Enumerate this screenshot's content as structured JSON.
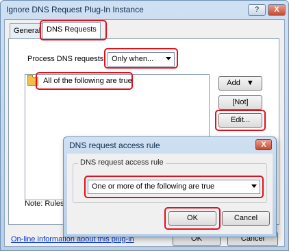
{
  "window": {
    "title": "Ignore DNS Request Plug-In Instance",
    "help_glyph": "?",
    "close_glyph": "X"
  },
  "tabs": [
    {
      "label": "General"
    },
    {
      "label": "DNS Requests"
    }
  ],
  "dns_requests": {
    "process_label": "Process DNS requests:",
    "process_value": "Only when...",
    "tree_item": "All of the following are true",
    "note": "Note: Rules"
  },
  "side_buttons": {
    "add": "Add",
    "add_arrow": "▼",
    "not": "[Not]",
    "edit": "Edit..."
  },
  "footer": {
    "link": "On-line information about this plug-in",
    "ok_partial": "OK",
    "cancel_partial": "Cancel"
  },
  "dialog": {
    "title": "DNS request access rule",
    "close_glyph": "X",
    "group_label": "DNS request access rule",
    "combo_value": "One or more of the following are true",
    "ok": "OK",
    "cancel": "Cancel"
  },
  "colors": {
    "highlight": "#e0101c",
    "link": "#0033cc",
    "titlebar": "#cfe0f2"
  }
}
